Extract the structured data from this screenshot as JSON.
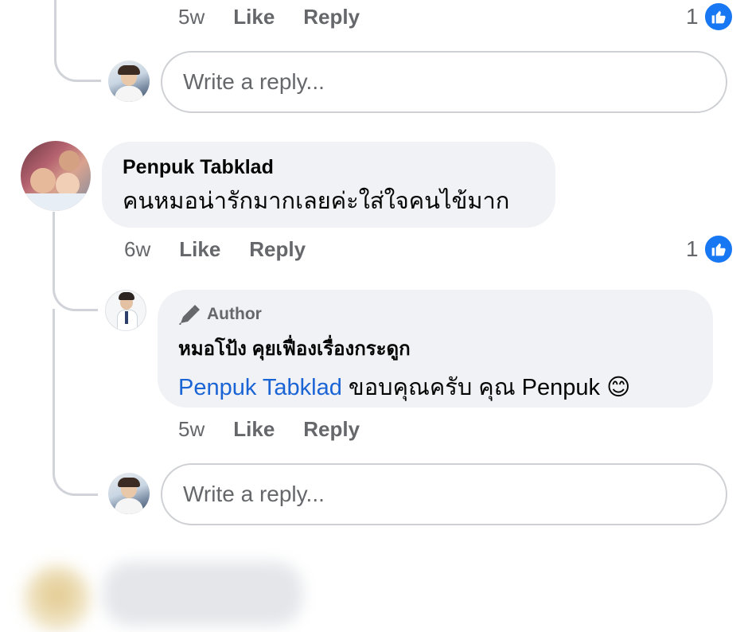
{
  "top_comment": {
    "time": "5w",
    "like_label": "Like",
    "reply_label": "Reply",
    "like_count": "1"
  },
  "reply_box_1": {
    "placeholder": "Write a reply..."
  },
  "comment": {
    "author": "Penpuk Tabklad",
    "text": "คนหมอน่ารักมากเลยค่ะใส่ใจคนไข้มาก",
    "time": "6w",
    "like_label": "Like",
    "reply_label": "Reply",
    "like_count": "1"
  },
  "reply": {
    "badge": "Author",
    "author": "หมอโป้ง คุยเฟื่องเรื่องกระดูก",
    "mention": "Penpuk Tabklad",
    "text": " ขอบคุณครับ คุณ Penpuk",
    "emoji": "😊",
    "time": "5w",
    "like_label": "Like",
    "reply_label": "Reply"
  },
  "reply_box_2": {
    "placeholder": "Write a reply..."
  },
  "colors": {
    "accent": "#1877f2",
    "bubble": "#f0f2f5",
    "meta": "#65676b",
    "mention": "#1b64d6"
  }
}
